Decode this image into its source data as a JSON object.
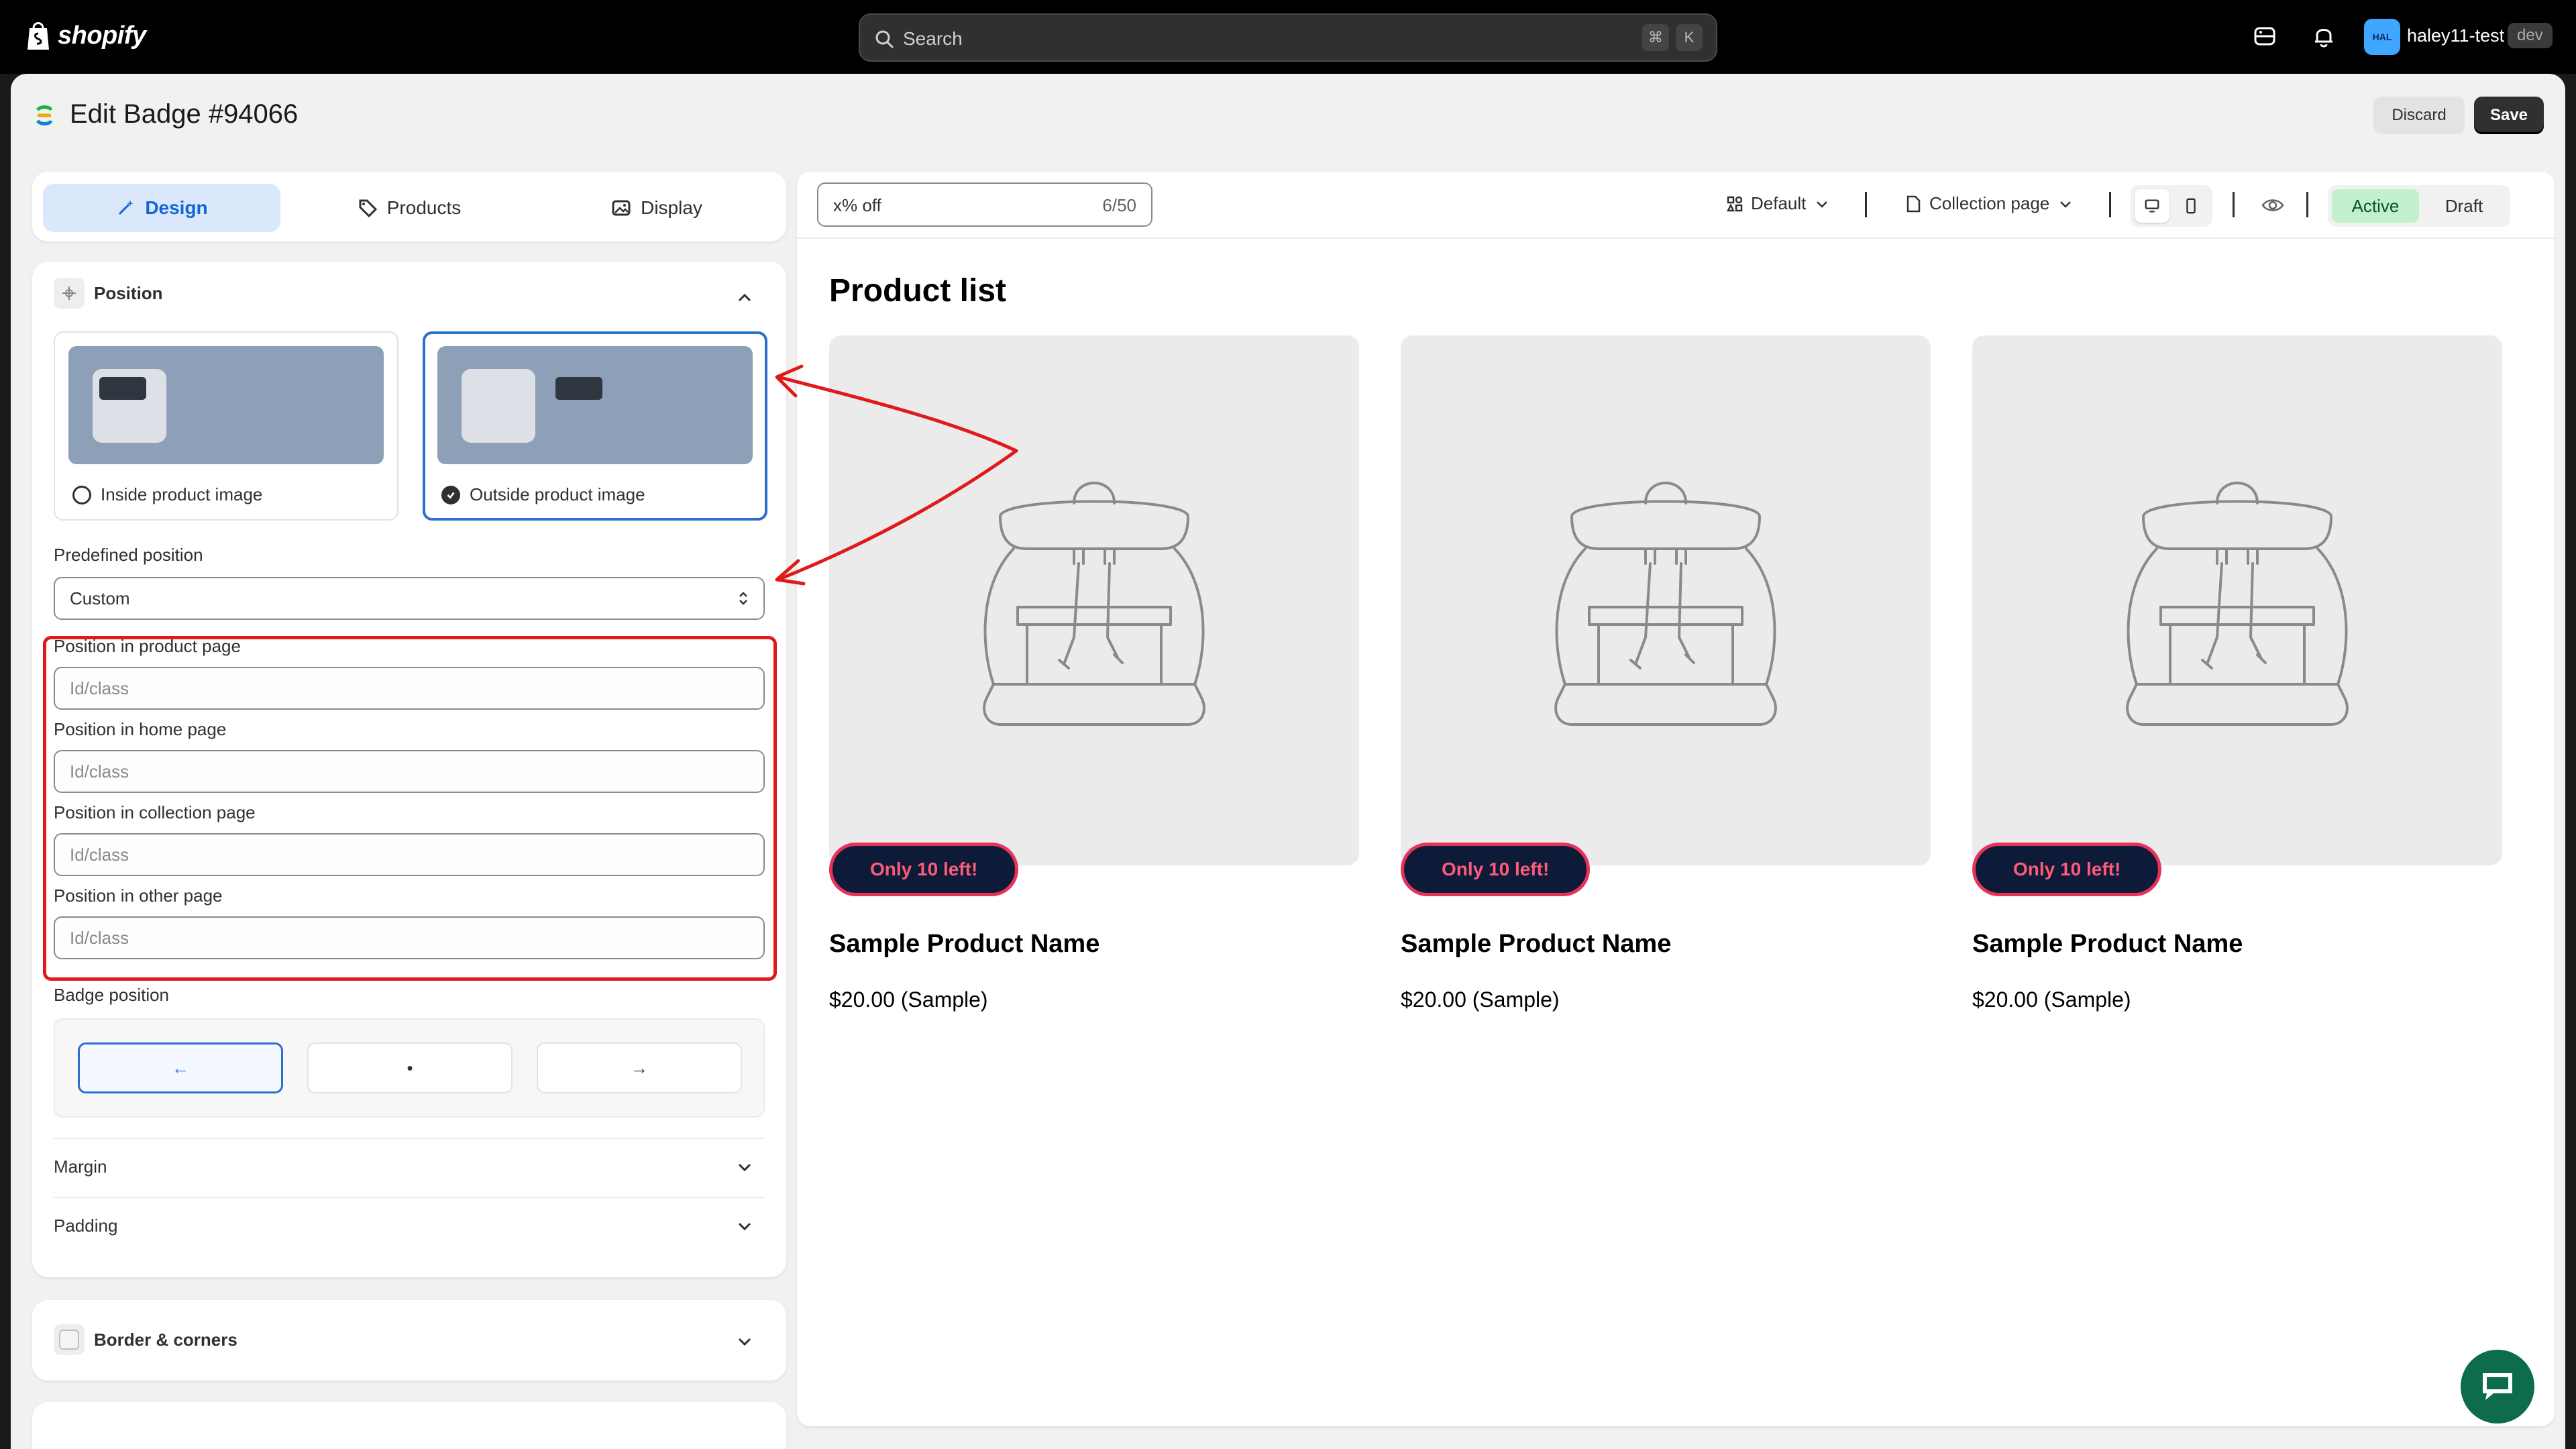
{
  "topbar": {
    "brand": "shopify",
    "search_placeholder": "Search",
    "shortcut_cmd": "⌘",
    "shortcut_key": "K",
    "avatar_initials": "HAL",
    "username": "haley11-test",
    "env_badge": "dev"
  },
  "header": {
    "title": "Edit Badge #94066",
    "discard_label": "Discard",
    "save_label": "Save"
  },
  "tabs": [
    {
      "label": "Design",
      "active": true
    },
    {
      "label": "Products",
      "active": false
    },
    {
      "label": "Display",
      "active": false
    }
  ],
  "position_section": {
    "title": "Position",
    "options": [
      {
        "label": "Inside product image",
        "selected": false
      },
      {
        "label": "Outside product image",
        "selected": true
      }
    ],
    "predefined_label": "Predefined position",
    "predefined_value": "Custom",
    "fields": [
      {
        "label": "Position in product page",
        "placeholder": "Id/class"
      },
      {
        "label": "Position in home page",
        "placeholder": "Id/class"
      },
      {
        "label": "Position in collection page",
        "placeholder": "Id/class"
      },
      {
        "label": "Position in other page",
        "placeholder": "Id/class"
      }
    ],
    "badge_position_label": "Badge position",
    "badge_position_options": [
      {
        "glyph": "←",
        "active": true
      },
      {
        "glyph": "•",
        "active": false
      },
      {
        "glyph": "→",
        "active": false
      }
    ],
    "margin_label": "Margin",
    "padding_label": "Padding"
  },
  "border_section": {
    "title": "Border & corners"
  },
  "preview_toolbar": {
    "text_value": "x% off",
    "text_count": "6/50",
    "theme_label": "Default",
    "page_label": "Collection page",
    "status_active": "Active",
    "status_draft": "Draft"
  },
  "preview": {
    "title": "Product list",
    "products": [
      {
        "badge": "Only 10 left!",
        "name": "Sample Product Name",
        "price": "$20.00 (Sample)"
      },
      {
        "badge": "Only 10 left!",
        "name": "Sample Product Name",
        "price": "$20.00 (Sample)"
      },
      {
        "badge": "Only 10 left!",
        "name": "Sample Product Name",
        "price": "$20.00 (Sample)"
      }
    ]
  },
  "colors": {
    "accent_blue": "#2c6ecb",
    "annotation_red": "#e01a1a",
    "badge_bg": "#0d1b38",
    "badge_border": "#e8325a",
    "active_green": "#c3f0cc"
  }
}
